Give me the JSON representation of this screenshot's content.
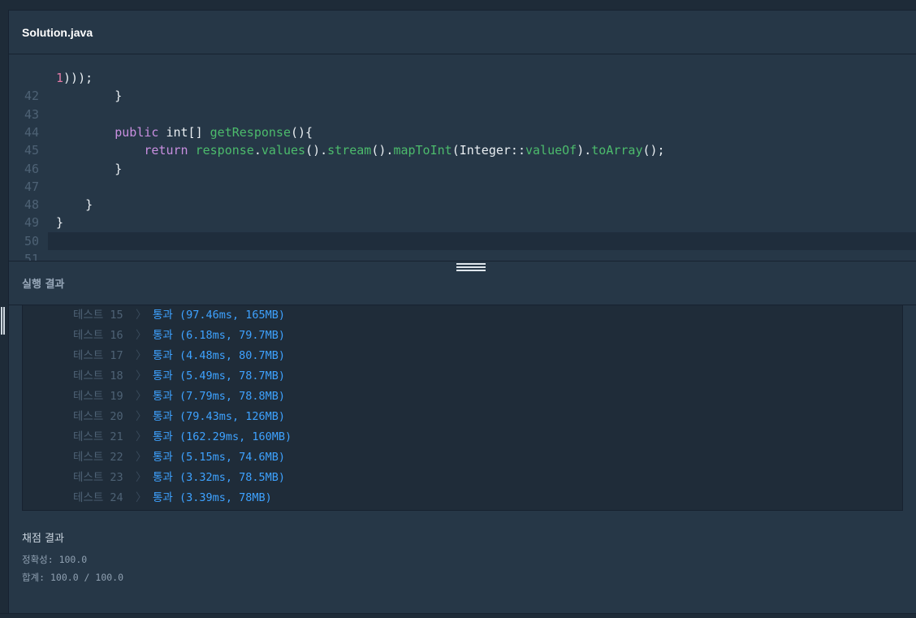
{
  "editor": {
    "file_tab": "Solution.java",
    "lines": [
      {
        "num": "",
        "code": [
          {
            "t": "1",
            "c": "num"
          },
          {
            "t": ")));",
            "c": ""
          }
        ]
      },
      {
        "num": "42",
        "code": [
          {
            "t": "        }",
            "c": ""
          }
        ]
      },
      {
        "num": "43",
        "code": []
      },
      {
        "num": "44",
        "code": [
          {
            "t": "        ",
            "c": ""
          },
          {
            "t": "public",
            "c": "kw"
          },
          {
            "t": " int[] ",
            "c": ""
          },
          {
            "t": "getResponse",
            "c": "fn"
          },
          {
            "t": "(){",
            "c": ""
          }
        ]
      },
      {
        "num": "45",
        "code": [
          {
            "t": "            ",
            "c": ""
          },
          {
            "t": "return",
            "c": "kw"
          },
          {
            "t": " ",
            "c": ""
          },
          {
            "t": "response",
            "c": "fn"
          },
          {
            "t": ".",
            "c": ""
          },
          {
            "t": "values",
            "c": "fn"
          },
          {
            "t": "().",
            "c": ""
          },
          {
            "t": "stream",
            "c": "fn"
          },
          {
            "t": "().",
            "c": ""
          },
          {
            "t": "mapToInt",
            "c": "fn"
          },
          {
            "t": "(Integer::",
            "c": ""
          },
          {
            "t": "valueOf",
            "c": "fn"
          },
          {
            "t": ").",
            "c": ""
          },
          {
            "t": "toArray",
            "c": "fn"
          },
          {
            "t": "();",
            "c": ""
          }
        ]
      },
      {
        "num": "46",
        "code": [
          {
            "t": "        }",
            "c": ""
          }
        ]
      },
      {
        "num": "47",
        "code": []
      },
      {
        "num": "48",
        "code": [
          {
            "t": "    }",
            "c": ""
          }
        ]
      },
      {
        "num": "49",
        "code": [
          {
            "t": "}",
            "c": ""
          }
        ]
      },
      {
        "num": "50",
        "code": [],
        "active": true
      },
      {
        "num": "51",
        "code": []
      }
    ]
  },
  "results": {
    "title": "실행 결과",
    "separator": "〉",
    "tests": [
      {
        "label": "테스트 15",
        "result": "통과 (97.46ms, 165MB)"
      },
      {
        "label": "테스트 16",
        "result": "통과 (6.18ms, 79.7MB)"
      },
      {
        "label": "테스트 17",
        "result": "통과 (4.48ms, 80.7MB)"
      },
      {
        "label": "테스트 18",
        "result": "통과 (5.49ms, 78.7MB)"
      },
      {
        "label": "테스트 19",
        "result": "통과 (7.79ms, 78.8MB)"
      },
      {
        "label": "테스트 20",
        "result": "통과 (79.43ms, 126MB)"
      },
      {
        "label": "테스트 21",
        "result": "통과 (162.29ms, 160MB)"
      },
      {
        "label": "테스트 22",
        "result": "통과 (5.15ms, 74.6MB)"
      },
      {
        "label": "테스트 23",
        "result": "통과 (3.32ms, 78.5MB)"
      },
      {
        "label": "테스트 24",
        "result": "통과 (3.39ms, 78MB)"
      }
    ]
  },
  "score": {
    "title": "채점 결과",
    "accuracy": "정확성: 100.0",
    "total": "합계: 100.0 / 100.0"
  }
}
